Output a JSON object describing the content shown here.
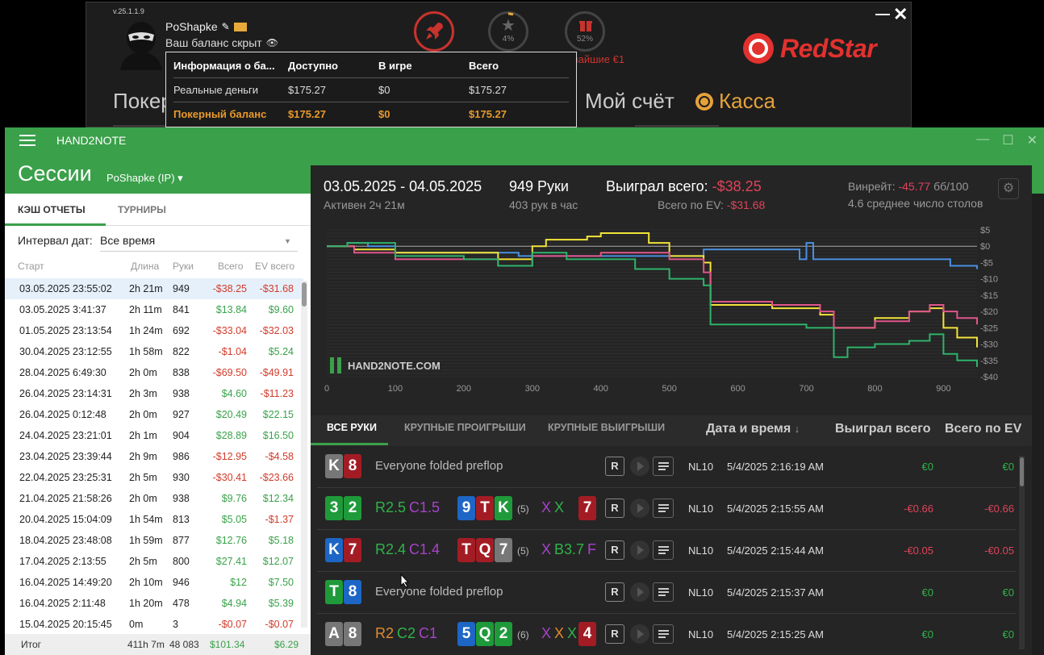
{
  "redstar": {
    "version": "v.25.1.1.9",
    "username": "PoShapke",
    "balance_hidden": "Ваш баланс скрыт",
    "star_pct": "4%",
    "gift_pct": "52%",
    "winner_text": "лайшие €1",
    "logo": "RedStar",
    "nav_poker": "Покер",
    "nav_account": "Мой счёт",
    "nav_cashier": "Касса",
    "minimize": "—",
    "close": "✕"
  },
  "balance_popup": {
    "headers": [
      "Информация о ба...",
      "Доступно",
      "В игре",
      "Всего"
    ],
    "rows": [
      [
        "Реальные деньги",
        "$175.27",
        "$0",
        "$175.27"
      ],
      [
        "Покерный баланс",
        "$175.27",
        "$0",
        "$175.27"
      ]
    ]
  },
  "h2n": {
    "title": "HAND2NOTE",
    "sessions_title": "Сессии",
    "user": "PoShapke (IP) ▾",
    "tab_cash": "КЭШ ОТЧЕТЫ",
    "tab_tourn": "ТУРНИРЫ",
    "interval_label": "Интервал дат:",
    "interval_value": "Все время",
    "headers": [
      "Старт",
      "Длина",
      "Руки",
      "Всего",
      "EV всего"
    ],
    "sessions": [
      {
        "start": "03.05.2025 23:55:02",
        "len": "2h 21m",
        "hands": "949",
        "total": "-$38.25",
        "ev": "-$31.68"
      },
      {
        "start": "03.05.2025 3:41:37",
        "len": "2h 11m",
        "hands": "841",
        "total": "$13.84",
        "ev": "$9.60"
      },
      {
        "start": "01.05.2025 23:13:54",
        "len": "1h 24m",
        "hands": "692",
        "total": "-$33.04",
        "ev": "-$32.03"
      },
      {
        "start": "30.04.2025 23:12:55",
        "len": "1h 58m",
        "hands": "822",
        "total": "-$1.04",
        "ev": "$5.24"
      },
      {
        "start": "28.04.2025 6:49:30",
        "len": "2h 0m",
        "hands": "838",
        "total": "-$69.50",
        "ev": "-$49.91"
      },
      {
        "start": "26.04.2025 23:14:31",
        "len": "2h 3m",
        "hands": "938",
        "total": "$4.60",
        "ev": "-$11.23"
      },
      {
        "start": "26.04.2025 0:12:48",
        "len": "2h 0m",
        "hands": "927",
        "total": "$20.49",
        "ev": "$22.15"
      },
      {
        "start": "24.04.2025 23:21:01",
        "len": "2h 1m",
        "hands": "904",
        "total": "$28.89",
        "ev": "$16.50"
      },
      {
        "start": "23.04.2025 23:39:44",
        "len": "2h 9m",
        "hands": "986",
        "total": "-$12.95",
        "ev": "-$4.58"
      },
      {
        "start": "22.04.2025 23:25:31",
        "len": "2h 5m",
        "hands": "930",
        "total": "-$30.41",
        "ev": "-$23.66"
      },
      {
        "start": "21.04.2025 21:58:26",
        "len": "2h 0m",
        "hands": "938",
        "total": "$9.76",
        "ev": "$12.34"
      },
      {
        "start": "20.04.2025 15:04:09",
        "len": "1h 54m",
        "hands": "813",
        "total": "$5.05",
        "ev": "-$1.37"
      },
      {
        "start": "18.04.2025 23:48:08",
        "len": "1h 59m",
        "hands": "877",
        "total": "$12.76",
        "ev": "$5.18"
      },
      {
        "start": "17.04.2025 2:13:55",
        "len": "2h 5m",
        "hands": "800",
        "total": "$27.41",
        "ev": "$12.07"
      },
      {
        "start": "16.04.2025 14:49:20",
        "len": "2h 10m",
        "hands": "946",
        "total": "$12",
        "ev": "$7.50"
      },
      {
        "start": "16.04.2025 2:11:48",
        "len": "1h 20m",
        "hands": "478",
        "total": "$4.94",
        "ev": "$5.39"
      },
      {
        "start": "15.04.2025 20:15:45",
        "len": "0m",
        "hands": "3",
        "total": "-$0.07",
        "ev": "-$0.07"
      }
    ],
    "total_row": {
      "label": "Итог",
      "len": "411h 7m",
      "hands": "48 083",
      "total": "$101.34",
      "ev": "$6.29"
    }
  },
  "summary": {
    "dates": "03.05.2025 - 04.05.2025",
    "active": "Активен 2ч 21м",
    "hands": "949 Руки",
    "per_hour": "403 рук в час",
    "won_label": "Выиграл всего: ",
    "won_value": "-$38.25",
    "ev_label": "Всего по EV: ",
    "ev_value": "-$31.68",
    "winrate_label": "Винрейт: ",
    "winrate_value": "-45.77",
    "winrate_unit": " бб/100",
    "tables": "4.6 среднее число столов",
    "watermark": "HAND2NOTE.COM"
  },
  "chart_data": {
    "type": "line",
    "xlim": [
      0,
      949
    ],
    "ylim": [
      -40,
      5
    ],
    "x_ticks": [
      0,
      100,
      200,
      300,
      400,
      500,
      600,
      700,
      800,
      900
    ],
    "y_ticks": [
      "$5",
      "$0",
      "-$5",
      "-$10",
      "-$15",
      "-$20",
      "-$25",
      "-$30",
      "-$35",
      "-$40"
    ],
    "series": [
      {
        "color": "#4a90e2",
        "points": [
          [
            0,
            0
          ],
          [
            30,
            1
          ],
          [
            60,
            0
          ],
          [
            100,
            -2
          ],
          [
            200,
            -2
          ],
          [
            280,
            -3
          ],
          [
            350,
            -3
          ],
          [
            450,
            -3
          ],
          [
            550,
            -1
          ],
          [
            650,
            -1
          ],
          [
            690,
            -1
          ],
          [
            690,
            -4
          ],
          [
            700,
            -4
          ],
          [
            700,
            1
          ],
          [
            710,
            1
          ],
          [
            710,
            -4
          ],
          [
            750,
            -4
          ],
          [
            900,
            -4
          ],
          [
            910,
            -6
          ],
          [
            949,
            -7
          ]
        ]
      },
      {
        "color": "#f2e33a",
        "points": [
          [
            0,
            0
          ],
          [
            40,
            -1
          ],
          [
            100,
            -2
          ],
          [
            200,
            -2
          ],
          [
            250,
            -4
          ],
          [
            300,
            0
          ],
          [
            320,
            2
          ],
          [
            380,
            3
          ],
          [
            400,
            4
          ],
          [
            470,
            1
          ],
          [
            500,
            -3
          ],
          [
            550,
            -5
          ],
          [
            560,
            -18
          ],
          [
            600,
            -18
          ],
          [
            650,
            -19
          ],
          [
            700,
            -19
          ],
          [
            720,
            -21
          ],
          [
            740,
            -25
          ],
          [
            800,
            -22
          ],
          [
            850,
            -20
          ],
          [
            880,
            -19
          ],
          [
            900,
            -25
          ],
          [
            920,
            -28
          ],
          [
            949,
            -31
          ]
        ]
      },
      {
        "color": "#e0568a",
        "points": [
          [
            0,
            0
          ],
          [
            40,
            -2
          ],
          [
            100,
            -4
          ],
          [
            200,
            -4
          ],
          [
            250,
            -6
          ],
          [
            300,
            -3
          ],
          [
            400,
            -2
          ],
          [
            500,
            -4
          ],
          [
            550,
            -8
          ],
          [
            560,
            -17
          ],
          [
            600,
            -17
          ],
          [
            650,
            -18
          ],
          [
            700,
            -18
          ],
          [
            720,
            -20
          ],
          [
            740,
            -25
          ],
          [
            800,
            -23
          ],
          [
            850,
            -20
          ],
          [
            880,
            -18
          ],
          [
            900,
            -20
          ],
          [
            920,
            -22
          ],
          [
            949,
            -24
          ]
        ]
      },
      {
        "color": "#2fb36a",
        "points": [
          [
            0,
            0
          ],
          [
            30,
            1
          ],
          [
            100,
            -3
          ],
          [
            200,
            -4
          ],
          [
            250,
            -6
          ],
          [
            300,
            -2
          ],
          [
            350,
            -4
          ],
          [
            400,
            -4
          ],
          [
            450,
            -7
          ],
          [
            500,
            -10
          ],
          [
            550,
            -12
          ],
          [
            560,
            -24
          ],
          [
            600,
            -24
          ],
          [
            650,
            -24
          ],
          [
            700,
            -25
          ],
          [
            740,
            -34
          ],
          [
            760,
            -31
          ],
          [
            800,
            -30
          ],
          [
            850,
            -29
          ],
          [
            880,
            -27
          ],
          [
            900,
            -33
          ],
          [
            920,
            -35
          ],
          [
            949,
            -37
          ]
        ]
      }
    ]
  },
  "hands_tabs": {
    "all": "ВСЕ РУКИ",
    "big_losses": "КРУПНЫЕ ПРОИГРЫШИ",
    "big_wins": "КРУПНЫЕ ВЫИГРЫШИ",
    "col_date": "Дата и время",
    "sort_arrow": "↓",
    "col_won": "Выиграл всего",
    "col_ev": "Всего по EV"
  },
  "hands": [
    {
      "cards": [
        [
          "K",
          "cgr"
        ],
        [
          "8",
          "cr"
        ]
      ],
      "text": "Everyone folded preflop",
      "limit": "NL10",
      "date": "5/4/2025 2:16:19 AM",
      "won": "€0",
      "ev": "€0"
    },
    {
      "cards": [
        [
          "3",
          "cg"
        ],
        [
          "2",
          "cg"
        ]
      ],
      "actions": [
        [
          "R2.5",
          "#2fb34a"
        ],
        [
          "C1.5",
          "#a643c9"
        ]
      ],
      "board": [
        [
          "9",
          "cb"
        ],
        [
          "T",
          "cr"
        ],
        [
          "K",
          "cg"
        ]
      ],
      "pot": "(5)",
      "post": [
        [
          "X",
          "#a643c9"
        ],
        [
          "X",
          "#2fb34a"
        ]
      ],
      "last": [
        [
          "7",
          "cr"
        ]
      ],
      "limit": "NL10",
      "date": "5/4/2025 2:15:55 AM",
      "won": "-€0.66",
      "ev": "-€0.66"
    },
    {
      "cards": [
        [
          "K",
          "cb"
        ],
        [
          "7",
          "cr"
        ]
      ],
      "actions": [
        [
          "R2.4",
          "#2fb34a"
        ],
        [
          "C1.4",
          "#a643c9"
        ]
      ],
      "board": [
        [
          "T",
          "cr"
        ],
        [
          "Q",
          "cr"
        ],
        [
          "7",
          "cgr"
        ]
      ],
      "pot": "(5)",
      "post": [
        [
          "X",
          "#a643c9"
        ],
        [
          "B3.7",
          "#2fb34a"
        ],
        [
          "F",
          "#a643c9"
        ]
      ],
      "limit": "NL10",
      "date": "5/4/2025 2:15:44 AM",
      "won": "-€0.05",
      "ev": "-€0.05"
    },
    {
      "cards": [
        [
          "T",
          "cg"
        ],
        [
          "8",
          "cb"
        ]
      ],
      "text": "Everyone folded preflop",
      "limit": "NL10",
      "date": "5/4/2025 2:15:37 AM",
      "won": "€0",
      "ev": "€0"
    },
    {
      "cards": [
        [
          "A",
          "cgr"
        ],
        [
          "8",
          "cgr"
        ]
      ],
      "actions": [
        [
          "R2",
          "#e08a2c"
        ],
        [
          "C2",
          "#2fb34a"
        ],
        [
          "C1",
          "#a643c9"
        ]
      ],
      "board": [
        [
          "5",
          "cb"
        ],
        [
          "Q",
          "cg"
        ],
        [
          "2",
          "cg"
        ]
      ],
      "pot": "(6)",
      "post": [
        [
          "X",
          "#a643c9"
        ],
        [
          "X",
          "#e08a2c"
        ],
        [
          "X",
          "#2fb34a"
        ]
      ],
      "last": [
        [
          "4",
          "cr"
        ]
      ],
      "limit": "NL10",
      "date": "5/4/2025 2:15:25 AM",
      "won": "€0",
      "ev": "€0"
    }
  ],
  "hand_buttons": {
    "replay": "R"
  }
}
